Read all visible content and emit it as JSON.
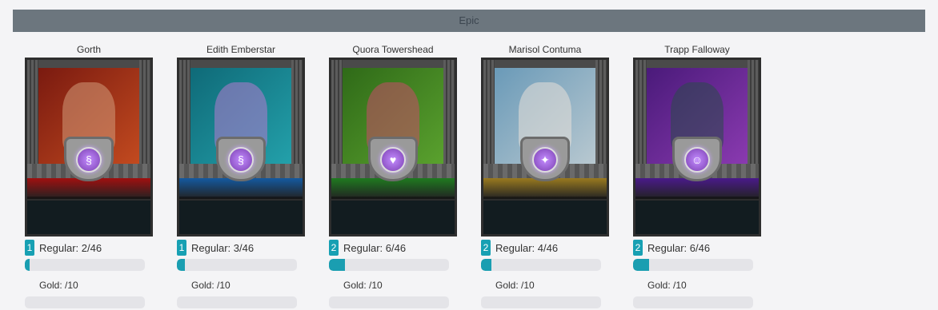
{
  "section": {
    "title": "Epic"
  },
  "cards": [
    {
      "name": "Gorth",
      "level": "1",
      "regular": "Regular: 2/46",
      "regular_progress": 0.04,
      "gold": "Gold: /10",
      "art": {
        "bg1": "#7a1a10",
        "bg2": "#c24a1f",
        "figure": "#d29a7a",
        "ribbon": "#a01010",
        "orb": "#7a3fb0",
        "symbol": "§"
      }
    },
    {
      "name": "Edith Emberstar",
      "level": "1",
      "regular": "Regular: 3/46",
      "regular_progress": 0.065,
      "gold": "Gold: /10",
      "art": {
        "bg1": "#0f6a78",
        "bg2": "#23a0aa",
        "figure": "#b47ad0",
        "ribbon": "#1459a0",
        "orb": "#7a3fb0",
        "symbol": "§"
      }
    },
    {
      "name": "Quora Towershead",
      "level": "2",
      "regular": "Regular: 6/46",
      "regular_progress": 0.13,
      "gold": "Gold: /10",
      "art": {
        "bg1": "#2f6a18",
        "bg2": "#5aa12e",
        "figure": "#c84a6a",
        "ribbon": "#1f7a20",
        "orb": "#7a3fb0",
        "symbol": "♥"
      }
    },
    {
      "name": "Marisol Contuma",
      "level": "2",
      "regular": "Regular: 4/46",
      "regular_progress": 0.087,
      "gold": "Gold: /10",
      "art": {
        "bg1": "#6a9ab8",
        "bg2": "#b8c8d0",
        "figure": "#e8e0d8",
        "ribbon": "#9a7a20",
        "orb": "#7a3fb0",
        "symbol": "✦"
      }
    },
    {
      "name": "Trapp Falloway",
      "level": "2",
      "regular": "Regular: 6/46",
      "regular_progress": 0.13,
      "gold": "Gold: /10",
      "art": {
        "bg1": "#4a1a7a",
        "bg2": "#8a3ab0",
        "figure": "#2a4a4a",
        "ribbon": "#4a1a8a",
        "orb": "#7a3fb0",
        "symbol": "☺"
      }
    }
  ]
}
